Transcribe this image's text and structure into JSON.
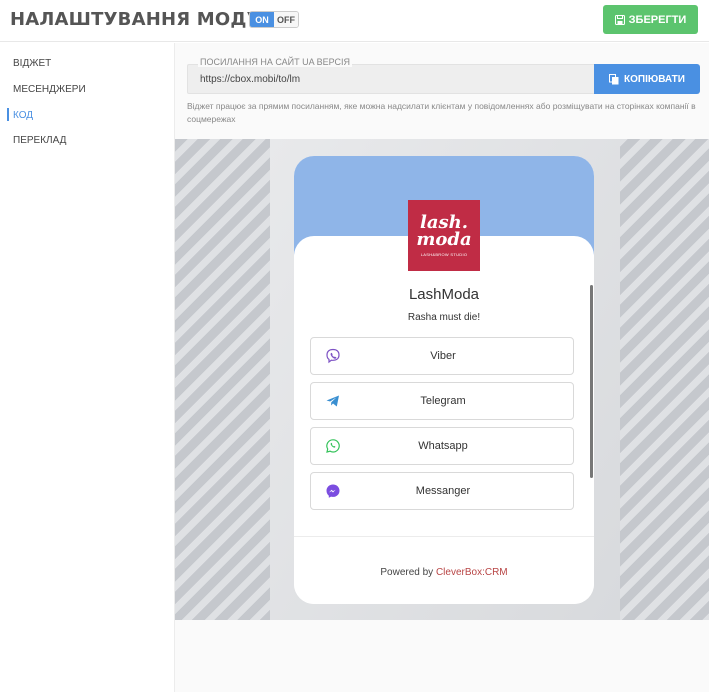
{
  "header": {
    "title": "НАЛАШТУВАННЯ МОДУЛЯ",
    "toggle_on": "ON",
    "toggle_off": "OFF",
    "save_label": "ЗБЕРЕГТИ",
    "save_color": "#5cc46e"
  },
  "sidebar": {
    "items": [
      {
        "label": "ВІДЖЕТ"
      },
      {
        "label": "МЕСЕНДЖЕРИ"
      },
      {
        "label": "КОД"
      },
      {
        "label": "ПЕРЕКЛАД"
      }
    ],
    "active_index": 2
  },
  "main": {
    "link_label": "ПОСИЛАННЯ НА САЙТ UA ВЕРСІЯ",
    "link_value": "https://cbox.mobi/to/lm",
    "copy_label": "КОПІЮВАТИ",
    "hint": "Віджет працює за прямим посиланням, яке можна надсилати клієнтам у повідомленнях або розміщувати на сторінках компанії в соцмережах",
    "accent_color": "#4a90e2"
  },
  "widget": {
    "logo_line1": "lash.",
    "logo_line2": "moda",
    "logo_sub": "LASH&BROW STUDIO",
    "name": "LashModa",
    "subtitle": "Rasha must die!",
    "messengers": [
      {
        "label": "Viber",
        "icon": "viber-icon",
        "color": "#7d52c4"
      },
      {
        "label": "Telegram",
        "icon": "telegram-icon",
        "color": "#3a8fd1"
      },
      {
        "label": "Whatsapp",
        "icon": "whatsapp-icon",
        "color": "#34c25a"
      },
      {
        "label": "Messanger",
        "icon": "messenger-icon",
        "color": "#7b4de0"
      }
    ],
    "powered_prefix": "Powered by",
    "powered_brand": "CleverBox:CRM"
  }
}
